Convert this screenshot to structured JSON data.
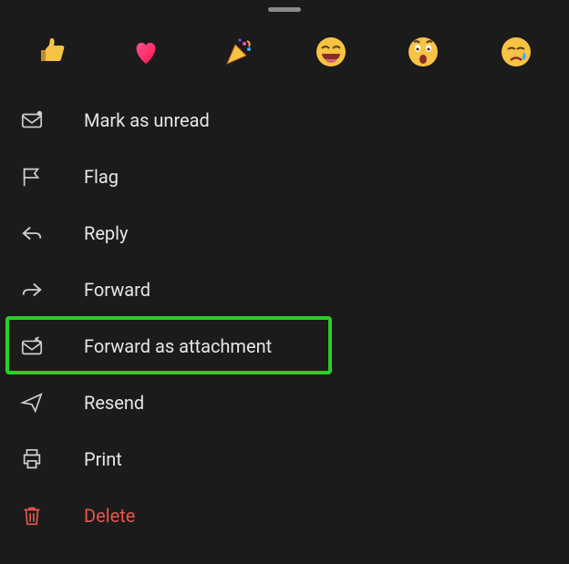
{
  "reactions": {
    "items": [
      {
        "name": "thumbs-up"
      },
      {
        "name": "heart"
      },
      {
        "name": "party"
      },
      {
        "name": "laugh"
      },
      {
        "name": "surprised"
      },
      {
        "name": "sad"
      }
    ]
  },
  "menu": {
    "items": [
      {
        "icon": "mark-unread",
        "label": "Mark as unread",
        "style": "normal",
        "highlighted": false
      },
      {
        "icon": "flag",
        "label": "Flag",
        "style": "normal",
        "highlighted": false
      },
      {
        "icon": "reply",
        "label": "Reply",
        "style": "normal",
        "highlighted": false
      },
      {
        "icon": "forward",
        "label": "Forward",
        "style": "normal",
        "highlighted": false
      },
      {
        "icon": "forward-attachment",
        "label": "Forward as attachment",
        "style": "normal",
        "highlighted": true
      },
      {
        "icon": "resend",
        "label": "Resend",
        "style": "normal",
        "highlighted": false
      },
      {
        "icon": "print",
        "label": "Print",
        "style": "normal",
        "highlighted": false
      },
      {
        "icon": "delete",
        "label": "Delete",
        "style": "danger",
        "highlighted": false
      }
    ]
  },
  "colors": {
    "background": "#1b1b1b",
    "text": "#e6e6e6",
    "danger": "#e8564f",
    "highlight": "#28d028"
  }
}
